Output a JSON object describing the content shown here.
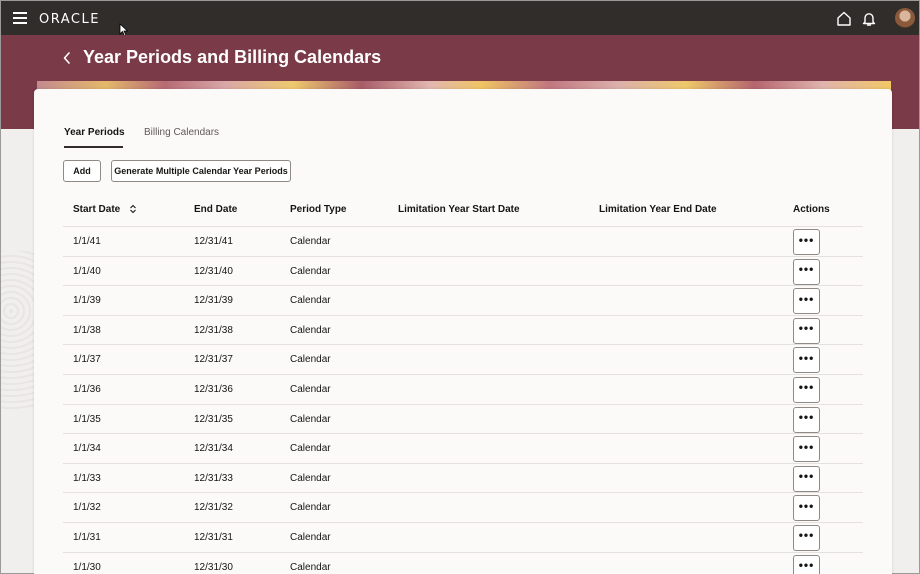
{
  "header": {
    "brand": "ORACLE",
    "icons": [
      "hamburger-menu-icon",
      "home-icon",
      "bell-icon",
      "avatar"
    ]
  },
  "page": {
    "title": "Year Periods and Billing Calendars"
  },
  "tabs": [
    {
      "label": "Year Periods",
      "active": true
    },
    {
      "label": "Billing Calendars",
      "active": false
    }
  ],
  "toolbar": {
    "add_label": "Add",
    "generate_label": "Generate Multiple Calendar Year Periods"
  },
  "table": {
    "columns": [
      "Start Date",
      "End Date",
      "Period Type",
      "Limitation Year Start Date",
      "Limitation Year End Date",
      "Actions"
    ],
    "rows": [
      {
        "start": "1/1/41",
        "end": "12/31/41",
        "type": "Calendar",
        "lim_start": "",
        "lim_end": ""
      },
      {
        "start": "1/1/40",
        "end": "12/31/40",
        "type": "Calendar",
        "lim_start": "",
        "lim_end": ""
      },
      {
        "start": "1/1/39",
        "end": "12/31/39",
        "type": "Calendar",
        "lim_start": "",
        "lim_end": ""
      },
      {
        "start": "1/1/38",
        "end": "12/31/38",
        "type": "Calendar",
        "lim_start": "",
        "lim_end": ""
      },
      {
        "start": "1/1/37",
        "end": "12/31/37",
        "type": "Calendar",
        "lim_start": "",
        "lim_end": ""
      },
      {
        "start": "1/1/36",
        "end": "12/31/36",
        "type": "Calendar",
        "lim_start": "",
        "lim_end": ""
      },
      {
        "start": "1/1/35",
        "end": "12/31/35",
        "type": "Calendar",
        "lim_start": "",
        "lim_end": ""
      },
      {
        "start": "1/1/34",
        "end": "12/31/34",
        "type": "Calendar",
        "lim_start": "",
        "lim_end": ""
      },
      {
        "start": "1/1/33",
        "end": "12/31/33",
        "type": "Calendar",
        "lim_start": "",
        "lim_end": ""
      },
      {
        "start": "1/1/32",
        "end": "12/31/32",
        "type": "Calendar",
        "lim_start": "",
        "lim_end": ""
      },
      {
        "start": "1/1/31",
        "end": "12/31/31",
        "type": "Calendar",
        "lim_start": "",
        "lim_end": ""
      },
      {
        "start": "1/1/30",
        "end": "12/31/30",
        "type": "Calendar",
        "lim_start": "",
        "lim_end": ""
      }
    ],
    "action_label": "•••"
  },
  "colors": {
    "topbar": "#312d2a",
    "banner": "#7a3a48",
    "card": "#fbfaf9",
    "background": "#f1efed"
  }
}
